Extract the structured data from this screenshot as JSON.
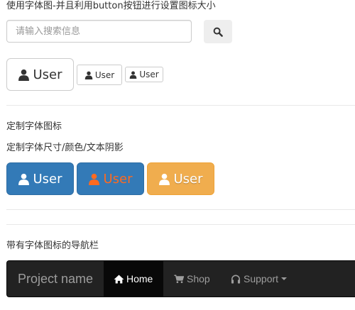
{
  "section1": {
    "title": "使用字体图-并且利用button按钮进行设置图标大小",
    "search": {
      "placeholder": "请输入搜索信息",
      "icon": "search-icon"
    },
    "buttons": [
      {
        "label": "User",
        "icon": "user-icon",
        "size": "large"
      },
      {
        "label": "User",
        "icon": "user-icon",
        "size": "small"
      },
      {
        "label": "User",
        "icon": "user-icon",
        "size": "extra-small"
      }
    ]
  },
  "section2": {
    "title": "定制字体图标",
    "subtitle": "定制字体尺寸/颜色/文本阴影",
    "buttons": [
      {
        "label": "User",
        "icon": "user-icon",
        "style": "primary",
        "color": "#ffffff"
      },
      {
        "label": "User",
        "icon": "user-icon",
        "style": "primary",
        "color": "#ff6a1f"
      },
      {
        "label": "User",
        "icon": "user-icon",
        "style": "warning",
        "color": "#ffffff"
      }
    ]
  },
  "section3": {
    "title": "带有字体图标的导航栏",
    "navbar": {
      "brand": "Project name",
      "items": [
        {
          "label": "Home",
          "icon": "home-icon",
          "active": true
        },
        {
          "label": "Shop",
          "icon": "shopping-cart-icon",
          "active": false
        },
        {
          "label": "Support",
          "icon": "headphones-icon",
          "active": false,
          "dropdown": true
        }
      ]
    }
  },
  "colors": {
    "primary": "#337ab7",
    "warning": "#f0ad4e",
    "orange_text": "#ff6a1f",
    "navbar_bg": "#222222",
    "navbar_active": "#080808",
    "navbar_text": "#9d9d9d"
  }
}
